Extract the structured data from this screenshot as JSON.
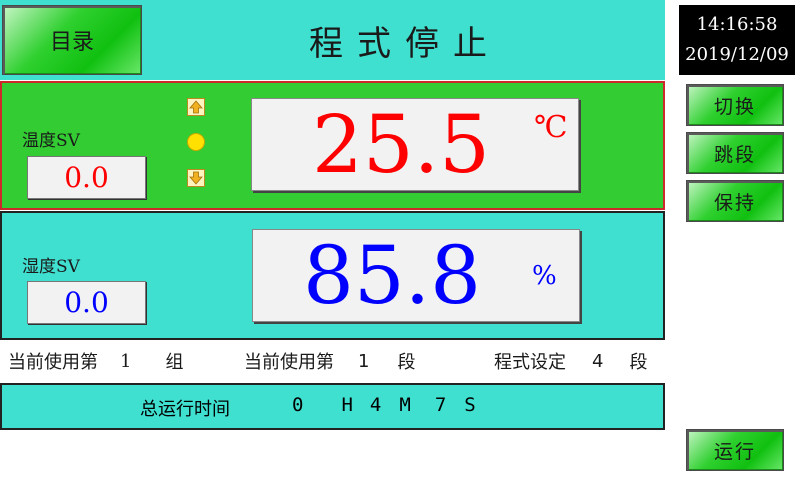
{
  "header": {
    "menu_label": "目录",
    "title": "程式停止"
  },
  "clock": {
    "time": "14:16:58",
    "date": "2019/12/09"
  },
  "side_buttons": {
    "switch_label": "切换",
    "skip_label": "跳段",
    "hold_label": "保持",
    "run_label": "运行"
  },
  "temperature": {
    "sv_label": "温度SV",
    "sv_value": "0.0",
    "pv_value": "25.5",
    "unit": "℃",
    "value_color": "#ff0000"
  },
  "humidity": {
    "sv_label": "湿度SV",
    "sv_value": "0.0",
    "pv_value": "85.8",
    "unit": "%",
    "value_color": "#0000ff"
  },
  "info": {
    "group_prefix": "当前使用第",
    "group_number": "1",
    "group_suffix": "组",
    "segment_prefix": "当前使用第",
    "segment_number": "1",
    "segment_suffix": "段",
    "program_prefix": "程式设定",
    "program_number": "4",
    "program_suffix": "段"
  },
  "runtime": {
    "label": "总运行时间",
    "hours": "0",
    "hours_unit": "H",
    "minutes": "4",
    "minutes_unit": "M",
    "seconds": "7",
    "seconds_unit": "S"
  },
  "icons": {
    "up": "arrow-up-icon",
    "status": "status-lamp-icon",
    "down": "arrow-down-icon"
  }
}
